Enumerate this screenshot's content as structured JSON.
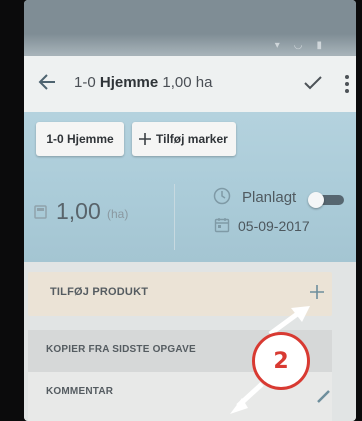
{
  "app_bar": {
    "title_prefix": "1-0",
    "title_bold": "Hjemme",
    "title_suffix": "1,00 ha"
  },
  "chips": {
    "field_label": "1-0 Hjemme",
    "add_markers_label": "Tilføj marker"
  },
  "summary": {
    "area_value": "1,00",
    "area_unit": "(ha)",
    "planned_label": "Planlagt",
    "planned_toggle_on": false,
    "date": "05-09-2017"
  },
  "rows": {
    "add_product": "TILFØJ PRODUKT",
    "copy_from_last_task": "KOPIER FRA SIDSTE OPGAVE",
    "comment": "KOMMENTAR"
  },
  "callout": {
    "number": "2",
    "color": "#d83a32"
  },
  "colors": {
    "header_blue": "#aacbd8",
    "app_bar": "#eef1f1",
    "product_row": "#ebe3d6"
  },
  "icons": [
    "back-arrow-icon",
    "check-icon",
    "more-vert-icon",
    "plus-icon",
    "calculator-icon",
    "clock-icon",
    "calendar-icon",
    "pencil-icon"
  ]
}
